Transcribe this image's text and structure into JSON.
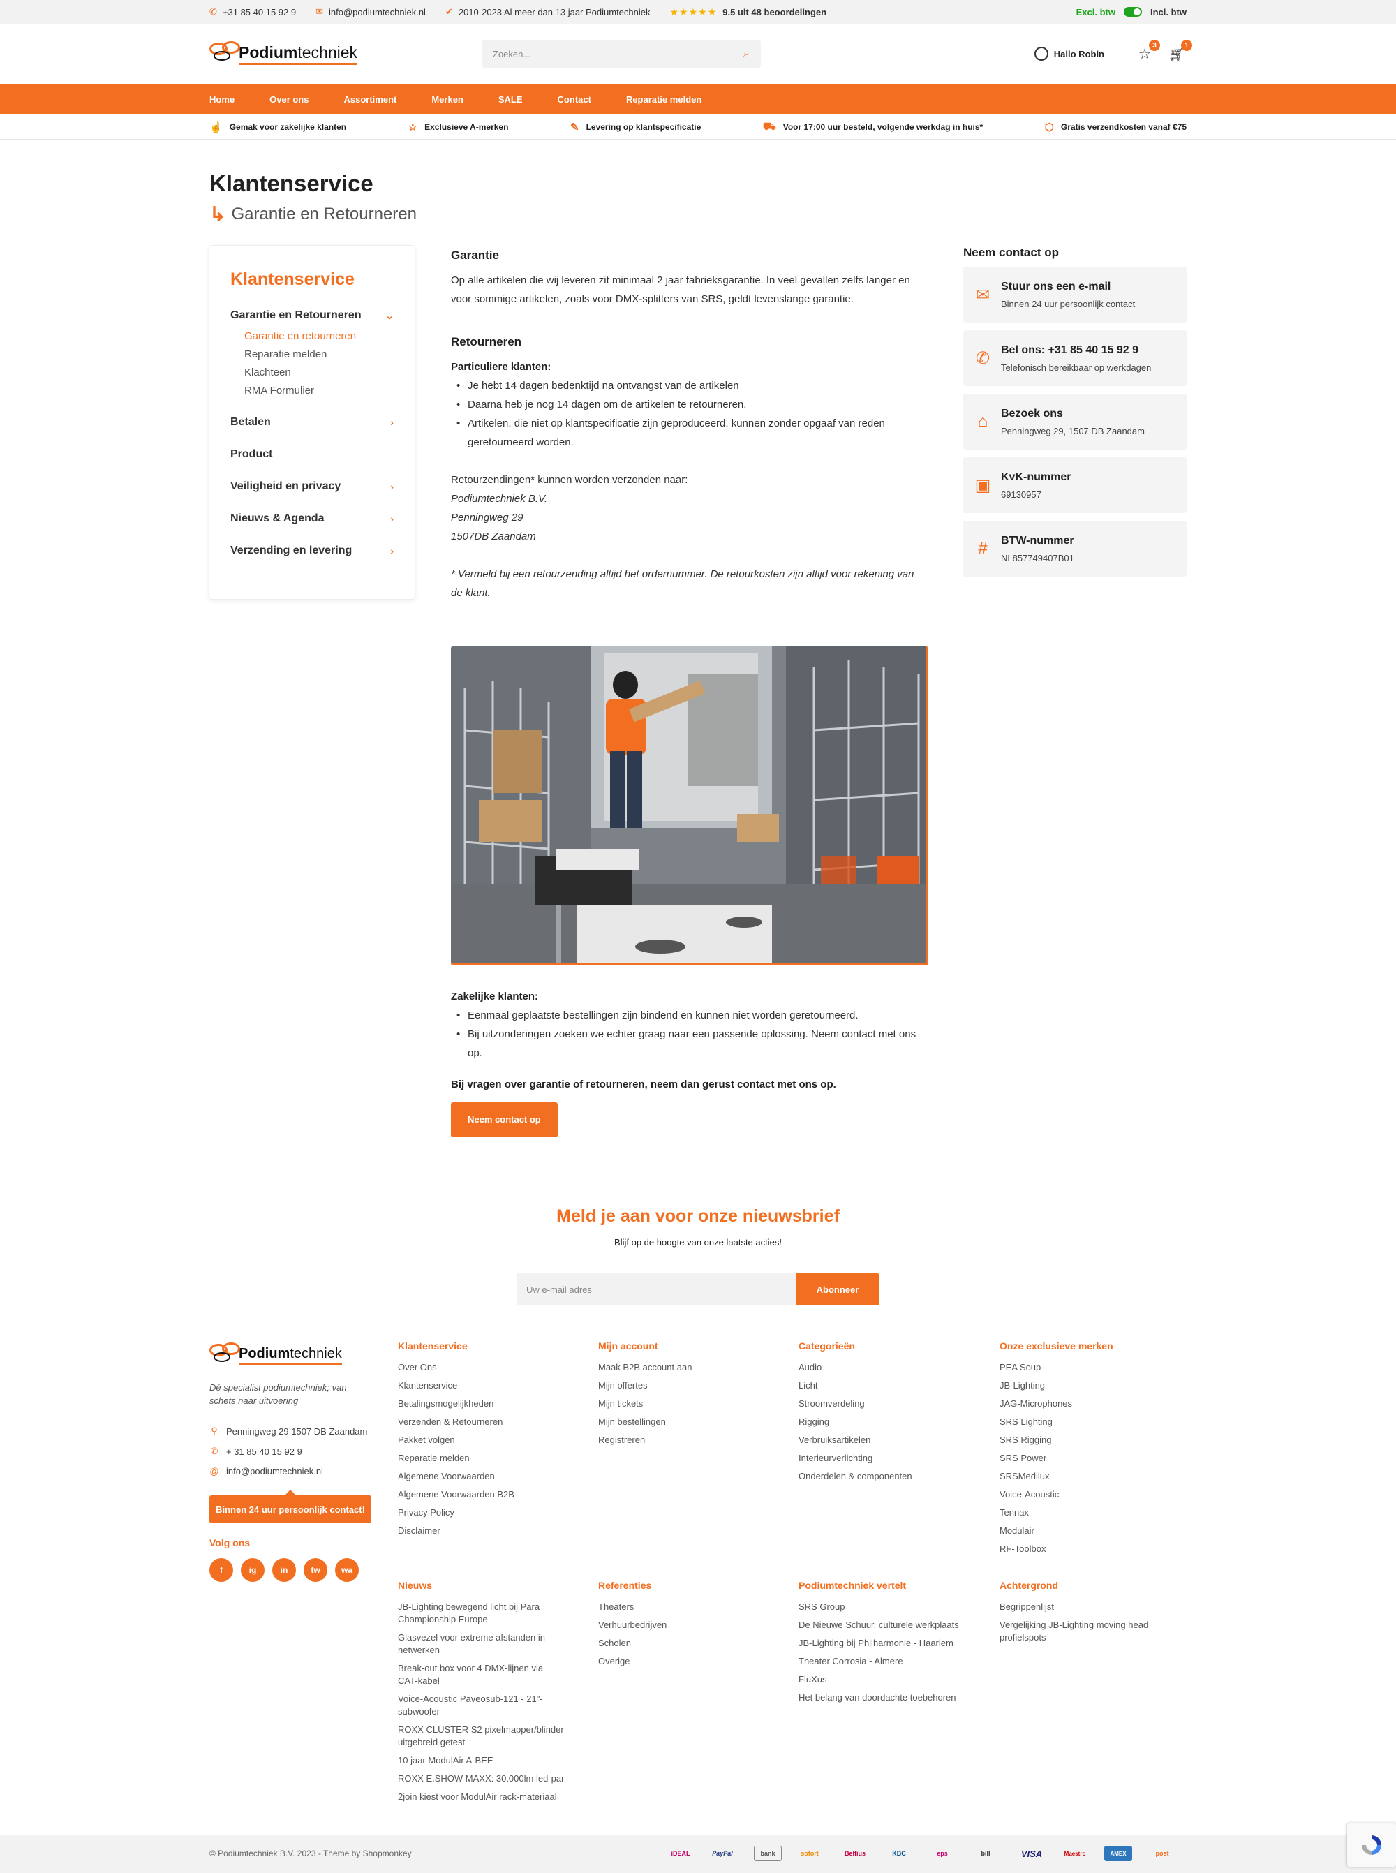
{
  "topbar": {
    "phone": "+31 85 40 15 92 9",
    "email": "info@podiumtechniek.nl",
    "since": "2010-2023 Al meer dan 13 jaar Podiumtechniek",
    "rating": "9.5 uit 48 beoordelingen",
    "excl": "Excl. btw",
    "incl": "Incl. btw"
  },
  "header": {
    "logo_bold": "Podium",
    "logo_light": "techniek",
    "search_placeholder": "Zoeken...",
    "user": "Hallo Robin",
    "wishlist_count": "3",
    "cart_count": "1"
  },
  "nav": [
    "Home",
    "Over ons",
    "Assortiment",
    "Merken",
    "SALE",
    "Contact",
    "Reparatie melden"
  ],
  "usp": [
    {
      "icon": "hand-icon",
      "label": "Gemak voor zakelijke klanten"
    },
    {
      "icon": "star-icon",
      "label": "Exclusieve A-merken"
    },
    {
      "icon": "pencil-icon",
      "label": "Levering op klantspecificatie"
    },
    {
      "icon": "cart-icon",
      "label": "Voor 17:00 uur besteld, volgende werkdag in huis*"
    },
    {
      "icon": "box-icon",
      "label": "Gratis verzendkosten vanaf €75"
    }
  ],
  "page": {
    "title": "Klantenservice",
    "subtitle": "Garantie en Retourneren"
  },
  "sidebar": {
    "title": "Klantenservice",
    "open_category": "Garantie en Retourneren",
    "subitems": [
      "Garantie en retourneren",
      "Reparatie melden",
      "Klachteen",
      "RMA Formulier"
    ],
    "categories": [
      "Betalen",
      "Product",
      "Veiligheid en privacy",
      "Nieuws & Agenda",
      "Verzending en levering"
    ]
  },
  "content": {
    "garantie_title": "Garantie",
    "garantie_text": "Op alle artikelen die wij leveren zit minimaal 2 jaar fabrieksgarantie. In veel gevallen zelfs langer en voor sommige artikelen, zoals voor DMX-splitters van SRS, geldt levenslange garantie.",
    "retour_title": "Retourneren",
    "particulier_title": "Particuliere klanten:",
    "particulier_items": [
      "Je hebt 14 dagen bedenktijd na ontvangst van de artikelen",
      "Daarna heb je nog 14 dagen om de artikelen te retourneren.",
      "Artikelen, die niet op klantspecificatie zijn geproduceerd, kunnen zonder opgaaf van reden geretourneerd worden."
    ],
    "retour_address_intro": "Retourzendingen* kunnen worden verzonden naar:",
    "address_lines": [
      "Podiumtechniek B.V.",
      "Penningweg 29",
      "1507DB Zaandam"
    ],
    "note": "* Vermeld bij een retourzending altijd het ordernummer. De retourkosten zijn altijd voor rekening van de klant.",
    "zakelijk_title": "Zakelijke klanten:",
    "zakelijk_items": [
      "Eenmaal geplaatste bestellingen zijn bindend en kunnen niet worden geretourneerd.",
      "Bij uitzonderingen zoeken we echter graag naar een passende oplossing. Neem contact met ons op."
    ],
    "closing": "Bij vragen over garantie of retourneren, neem dan gerust contact met ons op.",
    "button": "Neem contact op"
  },
  "contact": {
    "title": "Neem contact op",
    "cards": [
      {
        "icon": "mail-icon",
        "title": "Stuur ons een e-mail",
        "sub": "Binnen 24 uur persoonlijk contact"
      },
      {
        "icon": "phone-icon",
        "title": "Bel ons: +31 85 40 15 92 9",
        "sub": "Telefonisch bereikbaar op werkdagen"
      },
      {
        "icon": "store-icon",
        "title": "Bezoek ons",
        "sub": "Penningweg 29, 1507 DB Zaandam"
      },
      {
        "icon": "bookmark-icon",
        "title": "KvK-nummer",
        "sub": "69130957"
      },
      {
        "icon": "hash-icon",
        "title": "BTW-nummer",
        "sub": "NL857749407B01"
      }
    ]
  },
  "newsletter": {
    "title": "Meld je aan voor onze nieuwsbrief",
    "subtitle": "Blijf op de hoogte van onze laatste acties!",
    "placeholder": "Uw e-mail adres",
    "button": "Abonneer"
  },
  "footer": {
    "tagline": "Dé specialist podiumtechniek; van schets naar uitvoering",
    "address": "Penningweg 29  1507 DB Zaandam",
    "phone": "+ 31 85 40 15 92 9",
    "email": "info@podiumtechniek.nl",
    "cta": "Binnen 24 uur persoonlijk contact!",
    "follow": "Volg ons",
    "social": [
      "f",
      "ig",
      "in",
      "tw",
      "wa"
    ],
    "columns_top": [
      {
        "title": "Klantenservice",
        "links": [
          "Over Ons",
          "Klantenservice",
          "Betalingsmogelijkheden",
          "Verzenden & Retourneren",
          "Pakket volgen",
          "Reparatie melden",
          "Algemene Voorwaarden",
          "Algemene Voorwaarden B2B",
          "Privacy Policy",
          "Disclaimer"
        ]
      },
      {
        "title": "Mijn account",
        "links": [
          "Maak B2B account aan",
          "Mijn offertes",
          "Mijn tickets",
          "Mijn bestellingen",
          "Registreren"
        ]
      },
      {
        "title": "Categorieën",
        "links": [
          "Audio",
          "Licht",
          "Stroomverdeling",
          "Rigging",
          "Verbruiksartikelen",
          "Interieurverlichting",
          "Onderdelen & componenten"
        ]
      },
      {
        "title": "Onze exclusieve merken",
        "links": [
          "PEA Soup",
          "JB-Lighting",
          "JAG-Microphones",
          "SRS Lighting",
          "SRS Rigging",
          "SRS Power",
          "SRSMedilux",
          "Voice-Acoustic",
          "Tennax",
          "Modulair",
          "RF-Toolbox"
        ]
      }
    ],
    "columns_bottom": [
      {
        "title": "Nieuws",
        "links": [
          "JB-Lighting bewegend licht bij Para Championship Europe",
          "Glasvezel voor extreme afstanden in netwerken",
          "Break-out box voor 4 DMX-lijnen via CAT-kabel",
          "Voice-Acoustic Paveosub-121 - 21\"-subwoofer",
          "ROXX CLUSTER S2 pixelmapper/blinder uitgebreid getest",
          "10 jaar ModulAir A-BEE",
          "ROXX E.SHOW MAXX: 30.000lm led-par",
          "2join kiest voor ModulAir rack-materiaal"
        ]
      },
      {
        "title": "Referenties",
        "links": [
          "Theaters",
          "Verhuurbedrijven",
          "Scholen",
          "Overige"
        ]
      },
      {
        "title": "Podiumtechniek vertelt",
        "links": [
          "SRS Group",
          "De Nieuwe Schuur, culturele werkplaats",
          "JB-Lighting bij Philharmonie - Haarlem",
          "Theater Corrosia - Almere",
          "FluXus",
          "Het belang van doordachte toebehoren"
        ]
      },
      {
        "title": "Achtergrond",
        "links": [
          "Begrippenlijst",
          "Vergelijking JB-Lighting moving head profielspots"
        ]
      }
    ],
    "copyright": "© Podiumtechniek B.V. 2023 - Theme by Shopmonkey",
    "payments": [
      "iDEAL",
      "PayPal",
      "bank",
      "sofort",
      "Belfius",
      "KBC",
      "eps",
      "bill",
      "VISA",
      "Maestro",
      "AMEX",
      "post"
    ]
  }
}
